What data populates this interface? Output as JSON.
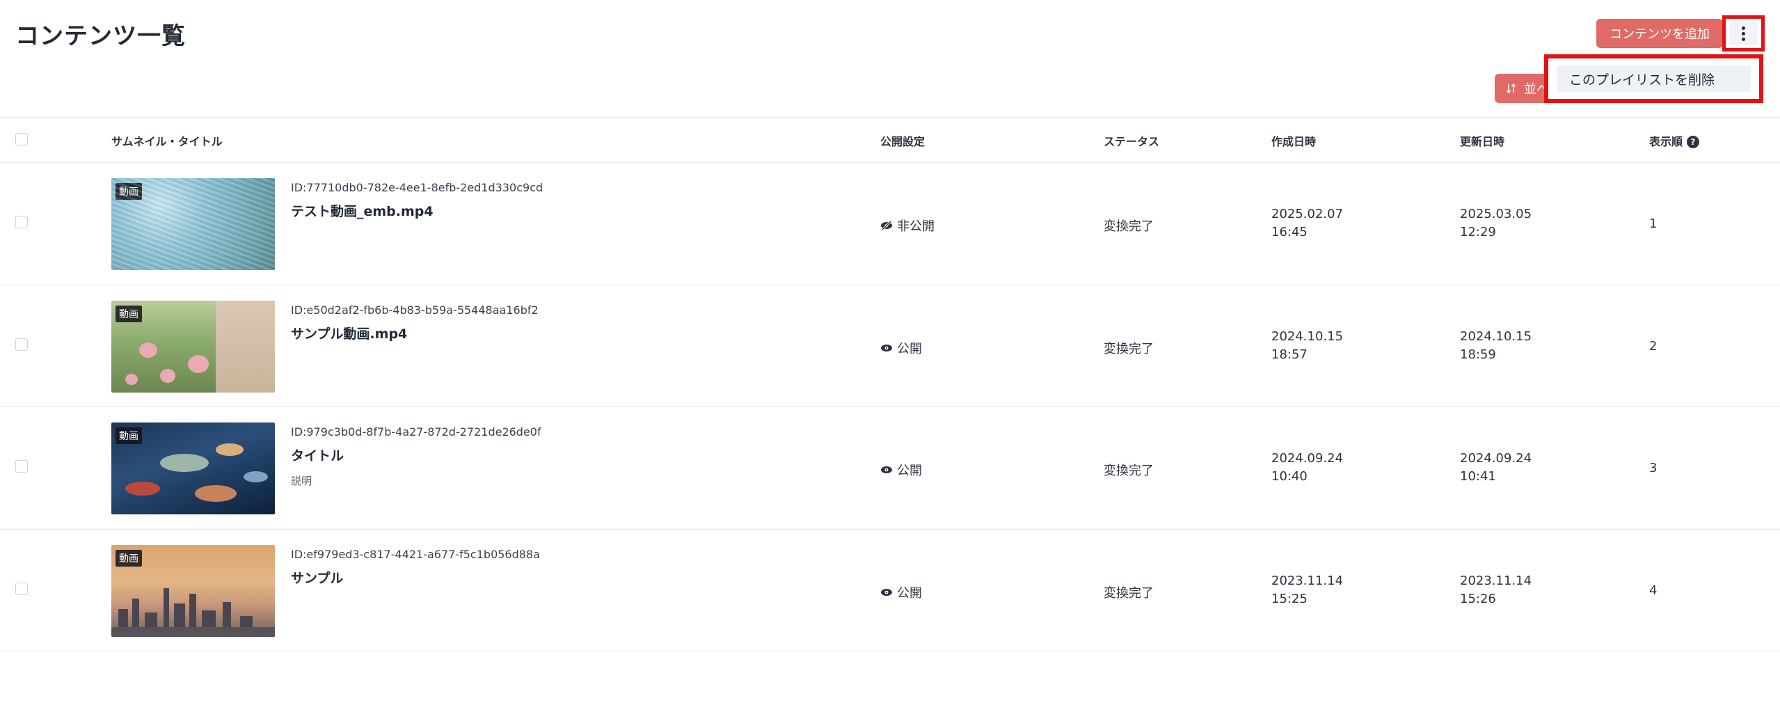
{
  "header": {
    "title": "コンテンツ一覧",
    "add_button_label": "コンテンツを追加",
    "more_menu_icon": "kebab-menu-icon",
    "sort_button_label": "並べ",
    "sort_icon": "sort-arrows-icon"
  },
  "dropdown_menu": {
    "items": [
      {
        "label": "このプレイリストを削除"
      }
    ]
  },
  "table": {
    "columns": {
      "thumbnail_title": "サムネイル・タイトル",
      "visibility": "公開設定",
      "status": "ステータス",
      "created_at": "作成日時",
      "updated_at": "更新日時",
      "display_order": "表示順"
    },
    "help_icon": "question-circle-icon",
    "rows": [
      {
        "badge": "動画",
        "id": "ID:77710db0-782e-4ee1-8efb-2ed1d330c9cd",
        "title": "テスト動画_emb.mp4",
        "description": "",
        "visibility": "非公開",
        "visibility_icon": "eye-slash-icon",
        "status": "変換完了",
        "created_date": "2025.02.07",
        "created_time": "16:45",
        "updated_date": "2025.03.05",
        "updated_time": "12:29",
        "order": "1"
      },
      {
        "badge": "動画",
        "id": "ID:e50d2af2-fb6b-4b83-b59a-55448aa16bf2",
        "title": "サンプル動画.mp4",
        "description": "",
        "visibility": "公開",
        "visibility_icon": "eye-icon",
        "status": "変換完了",
        "created_date": "2024.10.15",
        "created_time": "18:57",
        "updated_date": "2024.10.15",
        "updated_time": "18:59",
        "order": "2"
      },
      {
        "badge": "動画",
        "id": "ID:979c3b0d-8f7b-4a27-872d-2721de26de0f",
        "title": "タイトル",
        "description": "説明",
        "visibility": "公開",
        "visibility_icon": "eye-icon",
        "status": "変換完了",
        "created_date": "2024.09.24",
        "created_time": "10:40",
        "updated_date": "2024.09.24",
        "updated_time": "10:41",
        "order": "3"
      },
      {
        "badge": "動画",
        "id": "ID:ef979ed3-c817-4421-a677-f5c1b056d88a",
        "title": "サンプル",
        "description": "",
        "visibility": "公開",
        "visibility_icon": "eye-icon",
        "status": "変換完了",
        "created_date": "2023.11.14",
        "created_time": "15:25",
        "updated_date": "2023.11.14",
        "updated_time": "15:26",
        "order": "4"
      }
    ]
  },
  "colors": {
    "accent": "#e06a66",
    "highlight_frame": "#e31313",
    "divider": "#e7e9ee"
  }
}
